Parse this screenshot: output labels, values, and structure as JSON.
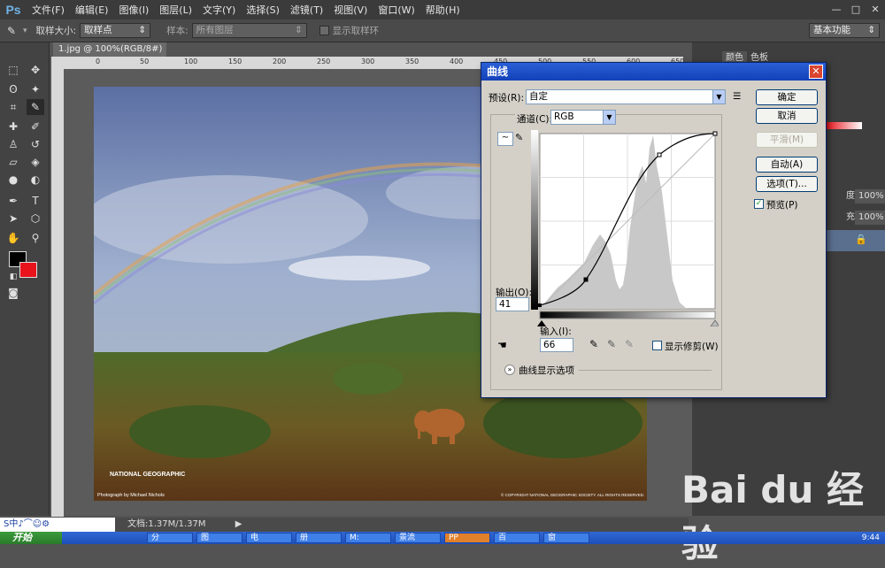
{
  "app": {
    "logo": "Ps"
  },
  "menu": [
    "文件(F)",
    "编辑(E)",
    "图像(I)",
    "图层(L)",
    "文字(Y)",
    "选择(S)",
    "滤镜(T)",
    "视图(V)",
    "窗口(W)",
    "帮助(H)"
  ],
  "window_controls": {
    "minimize": "—",
    "restore": "□",
    "close": "✕"
  },
  "options": {
    "sample_size_label": "取样大小:",
    "sample_size_value": "取样点",
    "sample_label": "样本:",
    "sample_value": "所有图层",
    "show_ring_label": "显示取样环",
    "workspace": "基本功能"
  },
  "document": {
    "tab_title": "1.jpg @ 100%(RGB/8#)",
    "tab_close": "×",
    "ruler_marks": [
      "0",
      "50",
      "100",
      "150",
      "200",
      "250",
      "300",
      "350",
      "400",
      "450",
      "500",
      "550",
      "600",
      "650"
    ],
    "status": "文档:1.37M/1.37M",
    "photo_logo": "NATIONAL GEOGRAPHIC",
    "photo_credit": "Photograph by Michael Nichols",
    "photo_copyright": "© COPYRIGHT NATIONAL GEOGRAPHIC SOCIETY. ALL RIGHTS RESERVED."
  },
  "panels": {
    "tab_color": "颜色",
    "tab_swatches": "色板",
    "opacity_label": "度:",
    "opacity_value": "100%",
    "fill_label": "充:",
    "fill_value": "100%"
  },
  "curves_dialog": {
    "title": "曲线",
    "close": "✕",
    "preset_label": "预设(R):",
    "preset_value": "自定",
    "channel_label": "通道(C):",
    "channel_value": "RGB",
    "output_label": "输出(O):",
    "output_value": "41",
    "input_label": "输入(I):",
    "input_value": "66",
    "show_clipping_label": "显示修剪(W)",
    "curve_options_label": "曲线显示选项",
    "buttons": {
      "ok": "确定",
      "cancel": "取消",
      "smooth": "平滑(M)",
      "auto": "自动(A)",
      "options": "选项(T)..."
    },
    "preview_label": "预览(P)",
    "preview_checked": true
  },
  "taskbar": {
    "start": "开始",
    "ime": "S中♪⌒☺⚙",
    "tasks": [
      "分",
      "图",
      "电",
      "册",
      "M:",
      "景流",
      "PP",
      "百",
      "窗"
    ],
    "clock": "9:44"
  },
  "watermark": {
    "text": "Bai du 经验"
  }
}
